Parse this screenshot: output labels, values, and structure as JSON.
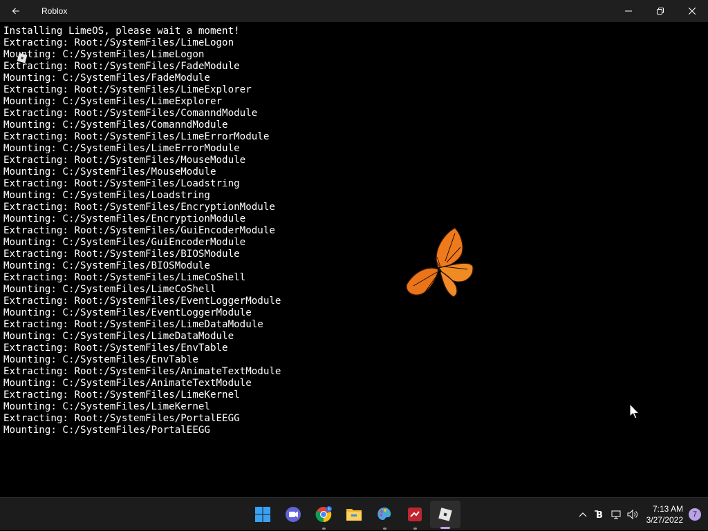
{
  "window": {
    "title": "Roblox"
  },
  "console": {
    "lines": [
      "Installing LimeOS, please wait a moment!",
      "Extracting: Root:/SystemFiles/LimeLogon",
      "Mounting: C:/SystemFiles/LimeLogon",
      "Extracting: Root:/SystemFiles/FadeModule",
      "Mounting: C:/SystemFiles/FadeModule",
      "Extracting: Root:/SystemFiles/LimeExplorer",
      "Mounting: C:/SystemFiles/LimeExplorer",
      "Extracting: Root:/SystemFiles/ComanndModule",
      "Mounting: C:/SystemFiles/ComanndModule",
      "Extracting: Root:/SystemFiles/LimeErrorModule",
      "Mounting: C:/SystemFiles/LimeErrorModule",
      "Extracting: Root:/SystemFiles/MouseModule",
      "Mounting: C:/SystemFiles/MouseModule",
      "Extracting: Root:/SystemFiles/Loadstring",
      "Mounting: C:/SystemFiles/Loadstring",
      "Extracting: Root:/SystemFiles/EncryptionModule",
      "Mounting: C:/SystemFiles/EncryptionModule",
      "Extracting: Root:/SystemFiles/GuiEncoderModule",
      "Mounting: C:/SystemFiles/GuiEncoderModule",
      "Extracting: Root:/SystemFiles/BIOSModule",
      "Mounting: C:/SystemFiles/BIOSModule",
      "Extracting: Root:/SystemFiles/LimeCoShell",
      "Mounting: C:/SystemFiles/LimeCoShell",
      "Extracting: Root:/SystemFiles/EventLoggerModule",
      "Mounting: C:/SystemFiles/EventLoggerModule",
      "Extracting: Root:/SystemFiles/LimeDataModule",
      "Mounting: C:/SystemFiles/LimeDataModule",
      "Extracting: Root:/SystemFiles/EnvTable",
      "Mounting: C:/SystemFiles/EnvTable",
      "Extracting: Root:/SystemFiles/AnimateTextModule",
      "Mounting: C:/SystemFiles/AnimateTextModule",
      "Extracting: Root:/SystemFiles/LimeKernel",
      "Mounting: C:/SystemFiles/LimeKernel",
      "Extracting: Root:/SystemFiles/PortalEEGG",
      "Mounting: C:/SystemFiles/PortalEEGG"
    ]
  },
  "taskbar": {
    "apps": [
      {
        "icon": "windows-start-icon",
        "active": false
      },
      {
        "icon": "teams-chat-icon",
        "active": false
      },
      {
        "icon": "chrome-icon",
        "active": false
      },
      {
        "icon": "file-explorer-icon",
        "active": false
      },
      {
        "icon": "paint-icon",
        "active": false
      },
      {
        "icon": "red-app-icon",
        "active": false
      },
      {
        "icon": "roblox-icon",
        "active": true
      }
    ],
    "tray": {
      "time": "7:13 AM",
      "date": "3/27/2022",
      "notification_count": "7"
    }
  },
  "colors": {
    "background": "#000000",
    "titlebar": "#1f1f1f",
    "taskbar": "#1c1c1c",
    "text": "#ffffff",
    "accent": "#c49bf3"
  }
}
